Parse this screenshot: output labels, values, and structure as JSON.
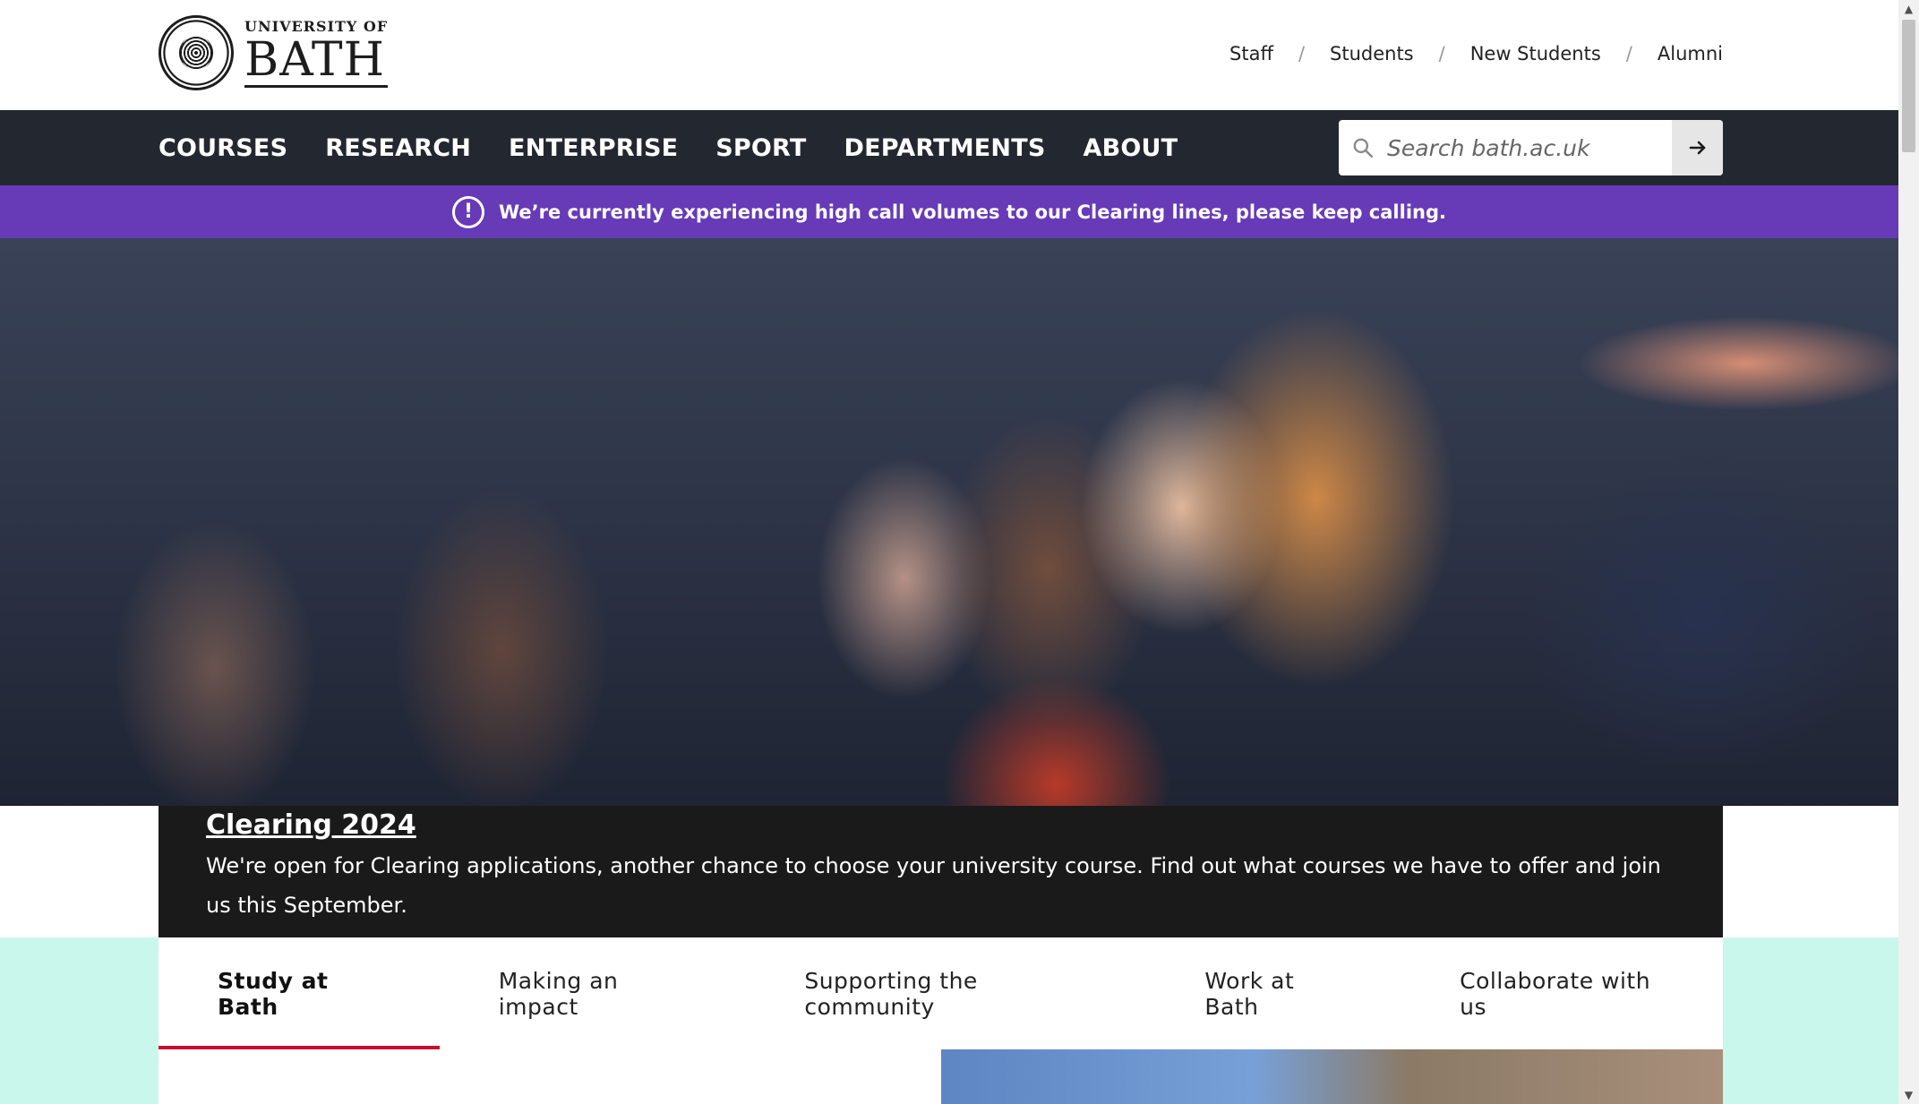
{
  "header": {
    "logo_small": "UNIVERSITY OF",
    "logo_big": "BATH",
    "util_links": [
      {
        "label": "Staff"
      },
      {
        "label": "Students"
      },
      {
        "label": "New Students"
      },
      {
        "label": "Alumni"
      }
    ],
    "separator": "/"
  },
  "nav": {
    "items": [
      {
        "label": "COURSES"
      },
      {
        "label": "RESEARCH"
      },
      {
        "label": "ENTERPRISE"
      },
      {
        "label": "SPORT"
      },
      {
        "label": "DEPARTMENTS"
      },
      {
        "label": "ABOUT"
      }
    ],
    "search": {
      "placeholder": "Search bath.ac.uk",
      "value": ""
    }
  },
  "alert": {
    "icon": "exclamation-circle-icon",
    "text": "We’re currently experiencing high call volumes to our Clearing lines, please keep calling."
  },
  "hero": {
    "caption_title": "Clearing 2024",
    "caption_text": "We're open for Clearing applications, another chance to choose your university course. Find out what courses we have to offer and join us this September."
  },
  "tabs": [
    {
      "label": "Study at Bath",
      "active": true
    },
    {
      "label": "Making an impact",
      "active": false
    },
    {
      "label": "Supporting the community",
      "active": false
    },
    {
      "label": "Work at Bath",
      "active": false
    },
    {
      "label": "Collaborate with us",
      "active": false
    }
  ],
  "colors": {
    "nav_bg": "#232730",
    "alert_bg": "#673ab7",
    "tab_active_underline": "#c8102e",
    "tabs_band_bg": "#c9f7ec"
  }
}
